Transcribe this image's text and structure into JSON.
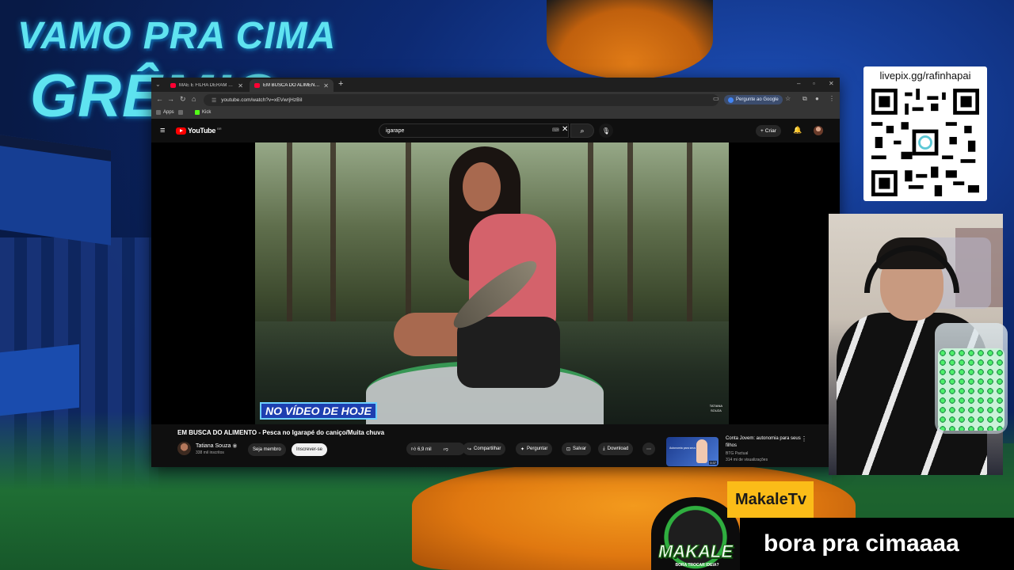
{
  "overlay": {
    "headline_line1": "VAMO PRA CIMA",
    "headline_line2": "GRÊMIO",
    "pix_url": "livepix.gg/rafinhapai",
    "streamer_name": "MakaleTv",
    "chat_message": "bora pra cimaaaa",
    "badge_title": "MAKALE",
    "badge_subtitle": "BORA TROCAR IDEIA?",
    "colors": {
      "name_tag": "#fbbc18",
      "headline": "#5fe3f0"
    }
  },
  "browser": {
    "tabs": [
      {
        "label": "MÃE E FILHA DERAM EM CIMA",
        "active": false,
        "icon": "youtube-favicon"
      },
      {
        "label": "EM BUSCA DO ALIMENTO - Pe",
        "active": true,
        "icon": "youtube-favicon"
      }
    ],
    "url": "youtube.com/watch?v=xEVwrjHzBiI",
    "ask_google_label": "Pergunte ao Google",
    "bookmarks": [
      {
        "label": "Apps",
        "icon": "apps-grid-icon"
      },
      {
        "label": "",
        "icon": "bookmark-folder-icon"
      },
      {
        "label": "Kick",
        "icon": "kick-favicon"
      }
    ]
  },
  "youtube": {
    "logo_text": "YouTube",
    "logo_country": "BR",
    "search_query": "igarape",
    "create_label": "Criar",
    "video": {
      "caption": "NO VÍDEO DE HOJE",
      "watermark_line1": "TATIANA",
      "watermark_line2": "SOUZA",
      "title": "EM BUSCA DO ALIMENTO - Pesca no Igarapé do caniço/Muita chuva",
      "channel": "Tatiana Souza",
      "subscribers": "338 mil inscritos",
      "join_label": "Seja membro",
      "subscribe_label": "Inscrever-se",
      "likes": "6,9 mil",
      "share_label": "Compartilhar",
      "ask_label": "Perguntar",
      "save_label": "Salvar",
      "download_label": "Download"
    },
    "recommendation": {
      "title": "Conta Jovem: autonomia para seus filhos",
      "channel": "BTG Pactual",
      "views": "314 mi de visualizações",
      "duration": "0:37",
      "thumb_text": "Autonomia para seus filhos"
    }
  }
}
